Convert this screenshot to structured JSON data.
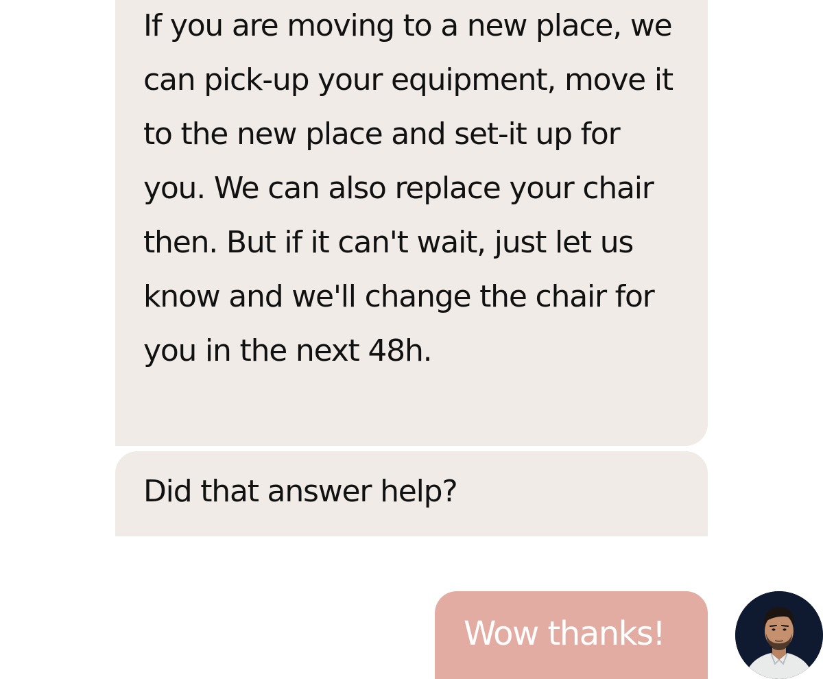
{
  "conversation": {
    "messages": [
      {
        "sender": "bot",
        "text": "If you are moving to a new place, we can pick-up your equipment, move it to the new place and set-it up for you. We can also replace your chair then. But if it can't wait, just let us know and we'll change the chair for you in the next 48h."
      },
      {
        "sender": "bot",
        "text": "Did that answer help?"
      },
      {
        "sender": "user",
        "text": "Wow thanks!"
      }
    ],
    "user_avatar": {
      "icon": "user-photo-avatar"
    }
  },
  "colors": {
    "bot_bubble": "#f0ebe6",
    "user_bubble": "#e3aca2",
    "user_text": "#ffffff",
    "avatar_background": "#0f1a30"
  }
}
